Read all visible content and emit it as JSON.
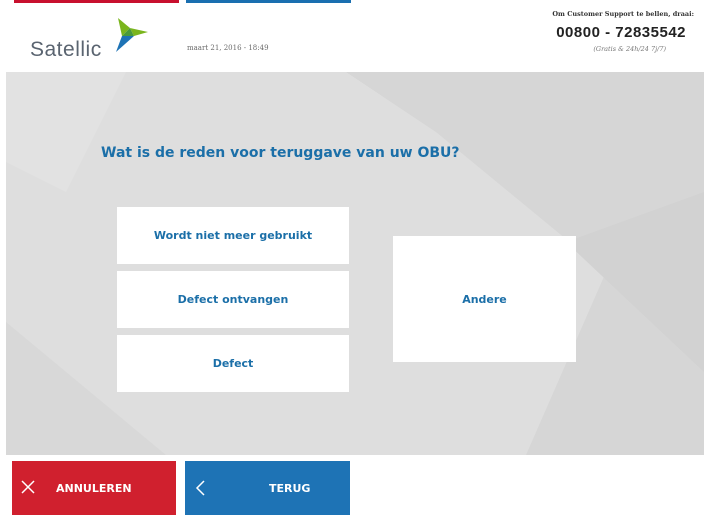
{
  "header": {
    "logo_text": "Satellic",
    "datetime": "maart 21, 2016 - 18:49",
    "support_label": "Om Customer Support te bellen, draai:",
    "support_phone": "00800 - 72835542",
    "support_note": "(Gratis & 24h/24 7j/7)"
  },
  "main": {
    "question": "Wat is de reden voor teruggave van uw OBU?",
    "options": [
      {
        "label": "Wordt niet meer gebruikt"
      },
      {
        "label": "Defect ontvangen"
      },
      {
        "label": "Defect"
      },
      {
        "label": "Andere"
      }
    ]
  },
  "footer": {
    "cancel_label": "ANNULEREN",
    "back_label": "TERUG"
  },
  "icons": {
    "cancel": "close-icon",
    "back": "chevron-left-icon",
    "logo": "satellic-logo-icon"
  },
  "colors": {
    "accent_blue": "#1b6fa8",
    "cancel_red": "#d0202e",
    "back_blue": "#1e73b5",
    "logo_green": "#7ab51d"
  }
}
